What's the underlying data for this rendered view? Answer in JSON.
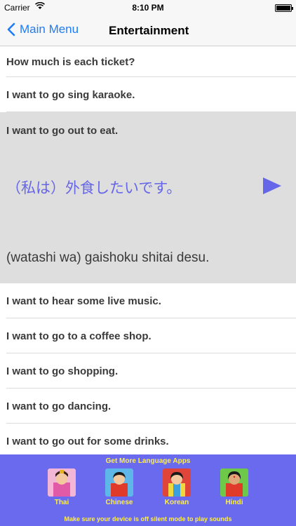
{
  "status": {
    "carrier": "Carrier",
    "time": "8:10 PM"
  },
  "nav": {
    "back_label": "Main Menu",
    "title": "Entertainment"
  },
  "phrases": {
    "p1": "How much is each ticket?",
    "p2": "I want to go sing karaoke.",
    "p3": "I want to go out to eat.",
    "p3_japanese": "（私は）外食したいです。",
    "p3_romaji": "(watashi wa) gaishoku shitai desu.",
    "p4": "I want to hear some live music.",
    "p5": "I want to go to a coffee shop.",
    "p6": "I want to go shopping.",
    "p7": "I want to go dancing.",
    "p8": "I want to go out for some drinks."
  },
  "footer": {
    "title": "Get More Language Apps",
    "apps": {
      "thai": "Thai",
      "chinese": "Chinese",
      "korean": "Korean",
      "hindi": "Hindi"
    },
    "notice": "Make sure your device is off silent mode to play sounds"
  },
  "colors": {
    "accent": "#1e7cf6",
    "japanese_text": "#6666e8",
    "footer_bg": "#6a6aee",
    "footer_text": "#ffef4a"
  }
}
